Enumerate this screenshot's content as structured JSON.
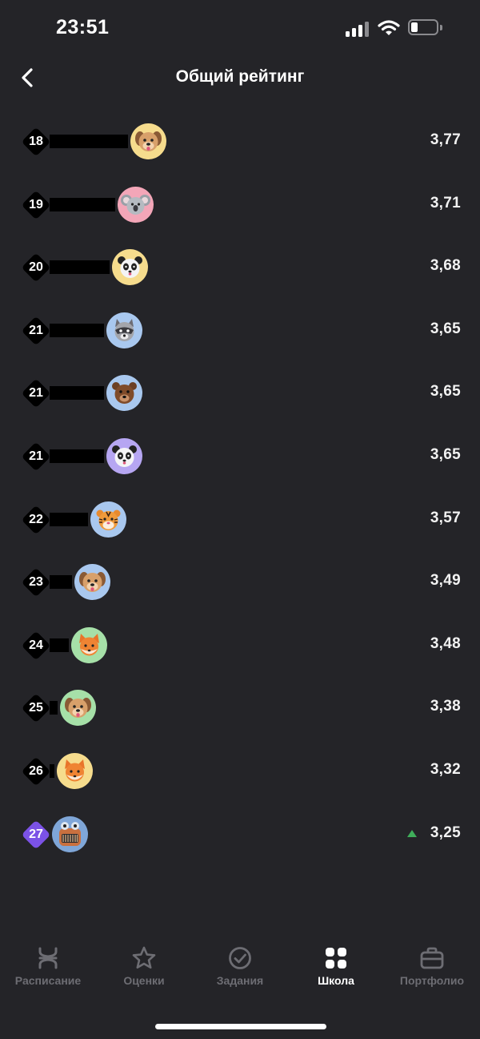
{
  "status_bar": {
    "time": "23:51"
  },
  "header": {
    "title": "Общий рейтинг"
  },
  "rows": [
    {
      "rank": "18",
      "score": "3,77",
      "avatar": "dog-avatar",
      "avatar_bg": "#f6dc8d"
    },
    {
      "rank": "19",
      "score": "3,71",
      "avatar": "koala-avatar",
      "avatar_bg": "#f3a6b8"
    },
    {
      "rank": "20",
      "score": "3,68",
      "avatar": "panda-avatar",
      "avatar_bg": "#f6dc8d"
    },
    {
      "rank": "21",
      "score": "3,65",
      "avatar": "raccoon-avatar",
      "avatar_bg": "#a9c8ef"
    },
    {
      "rank": "21",
      "score": "3,65",
      "avatar": "bear-avatar",
      "avatar_bg": "#a9c8ef"
    },
    {
      "rank": "21",
      "score": "3,65",
      "avatar": "panda-avatar",
      "avatar_bg": "#b6a6f2"
    },
    {
      "rank": "22",
      "score": "3,57",
      "avatar": "tiger-avatar",
      "avatar_bg": "#a9c8ef"
    },
    {
      "rank": "23",
      "score": "3,49",
      "avatar": "dog-avatar",
      "avatar_bg": "#a9c8ef"
    },
    {
      "rank": "24",
      "score": "3,48",
      "avatar": "fox-avatar",
      "avatar_bg": "#a6e0a8"
    },
    {
      "rank": "25",
      "score": "3,38",
      "avatar": "dog-avatar",
      "avatar_bg": "#a6e0a8"
    },
    {
      "rank": "26",
      "score": "3,32",
      "avatar": "fox-avatar",
      "avatar_bg": "#f6dc8d"
    },
    {
      "rank": "27",
      "score": "3,25",
      "avatar": "robot-avatar",
      "avatar_bg": "#7fa6d8",
      "current_user": true,
      "trend": "up"
    }
  ],
  "nav": {
    "items": [
      {
        "label": "Расписание",
        "icon": "schedule-icon"
      },
      {
        "label": "Оценки",
        "icon": "star-icon"
      },
      {
        "label": "Задания",
        "icon": "check-circle-icon"
      },
      {
        "label": "Школа",
        "icon": "school-grid-icon",
        "active": true
      },
      {
        "label": "Портфолио",
        "icon": "briefcase-icon"
      }
    ]
  },
  "colors": {
    "background": "#242428",
    "rank_badge": "#000000",
    "current_user_badge": "#7b52e6",
    "trend_up": "#3fae5a",
    "nav_inactive": "#6d6d73"
  }
}
